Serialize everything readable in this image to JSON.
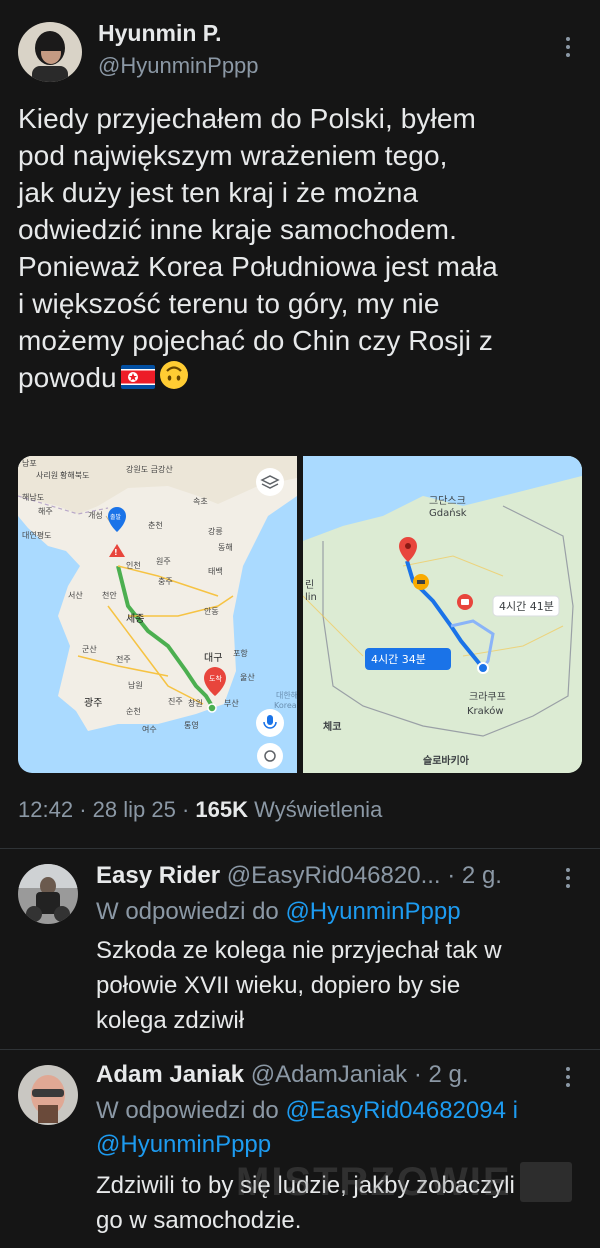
{
  "tweet": {
    "author_name": "Hyunmin P.",
    "author_handle": "@HyunminPppp",
    "text_lines": [
      "Kiedy przyjechałem do Polski, byłem",
      "pod największym wrażeniem tego,",
      "jak duży jest ten kraj i że można",
      "odwiedzić inne kraje samochodem.",
      "Ponieważ Korea Południowa jest mała",
      "i większość terenu to góry, my nie",
      "możemy pojechać do Chin czy Rosji z",
      "powodu"
    ],
    "emojis": [
      "north-korea-flag",
      "upside-down-face"
    ],
    "time": "12:42",
    "date": "28 lip 25",
    "views_count": "165K",
    "views_label": "Wyświetlenia",
    "meta_sep": "·"
  },
  "map_korea": {
    "labels": [
      "남포",
      "사리원",
      "황해북도",
      "강원도 금강산",
      "해남도",
      "해주",
      "개성",
      "출발",
      "대연평도",
      "춘천",
      "속초",
      "강릉",
      "동해",
      "태백",
      "원주",
      "충주",
      "인천",
      "서산",
      "천안",
      "안동",
      "세종",
      "군산",
      "전주",
      "대구",
      "포항",
      "울산",
      "광주",
      "남원",
      "진주",
      "창원",
      "부산",
      "순천",
      "여수",
      "통영",
      "도착",
      "대한해협",
      "Korea"
    ]
  },
  "map_poland": {
    "labels": [
      "그단스크",
      "Gdańsk",
      "4시간 41분",
      "4시간 34분",
      "크라쿠프",
      "Kraków",
      "체코",
      "슬로바키아",
      "린",
      "lin"
    ]
  },
  "replies": [
    {
      "name": "Easy Rider",
      "handle": "@EasyRid046820...",
      "sep": "·",
      "age": "2 g.",
      "reply_prefix": "W odpowiedzi do",
      "reply_to": [
        "@HyunminPppp"
      ],
      "text_lines": [
        "Szkoda ze kolega nie przyjechał tak w",
        "połowie XVII wieku, dopiero by sie",
        "kolega zdziwił"
      ]
    },
    {
      "name": "Adam Janiak",
      "handle": "@AdamJaniak",
      "sep": "·",
      "age": "2 g.",
      "reply_prefix": "W odpowiedzi do",
      "reply_to": [
        "@EasyRid04682094",
        "i",
        "@HyunminPppp"
      ],
      "text_lines": [
        "Zdziwili to by się ludzie, jakby zobaczyli",
        "go w samochodzie."
      ]
    }
  ],
  "watermark": "MISTRZOWIE",
  "colors": {
    "background": "#151515",
    "link": "#1d9bf0",
    "muted": "#8b98a5",
    "text": "#e7e9ea"
  }
}
